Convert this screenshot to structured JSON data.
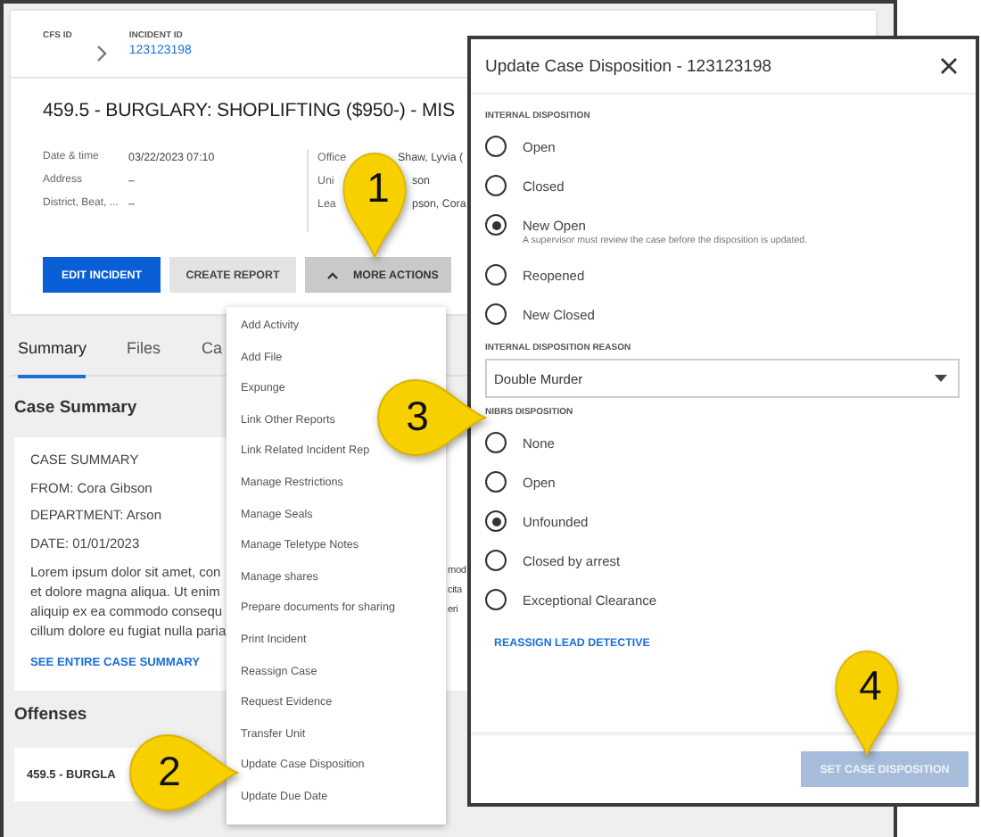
{
  "breadcrumb": [
    {
      "label": "CFS ID"
    },
    {
      "label": "INCIDENT ID",
      "value": "123123198"
    }
  ],
  "incident_title": "459.5 - BURGLARY: SHOPLIFTING ($950-) - MIS",
  "details_left": [
    {
      "label": "Date & time",
      "value": "03/22/2023 07:10"
    },
    {
      "label": "Address",
      "value": "–"
    },
    {
      "label": "District, Beat, ...",
      "value": "–"
    }
  ],
  "details_right": [
    {
      "label": "Office",
      "value": "Shaw, Lyvia ("
    },
    {
      "label": "Uni",
      "value": "son"
    },
    {
      "label": "Lea",
      "value": "pson, Cora"
    }
  ],
  "actions": [
    {
      "label": "EDIT INCIDENT",
      "kind": "primary"
    },
    {
      "label": "CREATE REPORT",
      "kind": "secondary"
    },
    {
      "label": "MORE ACTIONS",
      "kind": "menu",
      "expanded": true
    }
  ],
  "tabs": [
    {
      "label": "Summary",
      "selected": true
    },
    {
      "label": "Files",
      "selected": false
    },
    {
      "label": "Ca",
      "selected": false
    }
  ],
  "case_summary": {
    "heading": "Case Summary",
    "lines": [
      "CASE SUMMARY",
      "FROM: Cora Gibson",
      "DEPARTMENT: Arson",
      "DATE: 01/01/2023"
    ],
    "paragraph_lines": [
      "Lorem ipsum dolor sit amet, con",
      "et dolore magna aliqua. Ut enim",
      "aliquip ex ea commodo consequ",
      "cillum dolore eu fugiat nulla paria"
    ],
    "paragraph_right": [
      "mod",
      "cita",
      "eri"
    ],
    "link": "SEE ENTIRE CASE SUMMARY"
  },
  "offenses": {
    "heading": "Offenses",
    "card": "459.5 - BURGLA"
  },
  "actions_menu": [
    "Add Activity",
    "Add File",
    "Expunge",
    "Link Other Reports",
    "Link Related Incident Rep",
    "Manage Restrictions",
    "Manage Seals",
    "Manage Teletype Notes",
    "Manage shares",
    "Prepare documents for sharing",
    "Print Incident",
    "Reassign Case",
    "Request Evidence",
    "Transfer Unit",
    "Update Case Disposition",
    "Update Due Date"
  ],
  "modal": {
    "title": "Update Case Disposition - 123123198",
    "sections": [
      {
        "kind": "radio",
        "label": "INTERNAL DISPOSITION",
        "options": [
          {
            "label": "Open",
            "selected": false
          },
          {
            "label": "Closed",
            "selected": false
          },
          {
            "label": "New Open",
            "selected": true,
            "hint": "A supervisor must review the case before the disposition is updated."
          },
          {
            "label": "Reopened",
            "selected": false
          },
          {
            "label": "New Closed",
            "selected": false
          }
        ]
      },
      {
        "kind": "select",
        "label": "INTERNAL DISPOSITION REASON",
        "value": "Double Murder"
      },
      {
        "kind": "radio",
        "label": "NIBRS DISPOSITION",
        "options": [
          {
            "label": "None",
            "selected": false
          },
          {
            "label": "Open",
            "selected": false
          },
          {
            "label": "Unfounded",
            "selected": true
          },
          {
            "label": "Closed by arrest",
            "selected": false
          },
          {
            "label": "Exceptional Clearance",
            "selected": false
          }
        ]
      }
    ],
    "link": "REASSIGN LEAD DETECTIVE",
    "submit": {
      "label": "SET CASE DISPOSITION",
      "disabled": true
    }
  },
  "callouts": [
    {
      "number": "1",
      "kind": "down"
    },
    {
      "number": "2",
      "kind": "right"
    },
    {
      "number": "3",
      "kind": "right"
    },
    {
      "number": "4",
      "kind": "down"
    }
  ]
}
